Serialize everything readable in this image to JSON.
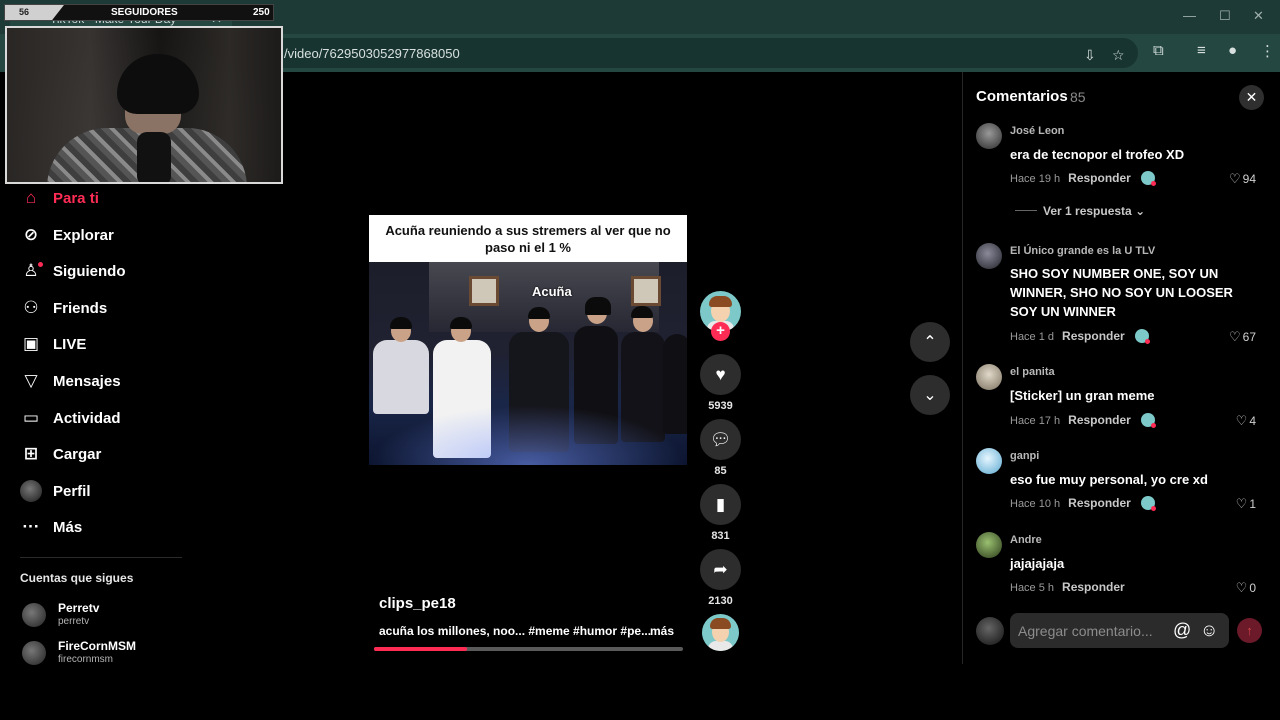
{
  "browser": {
    "tab_title": "TikTok - Make Your Day",
    "url": "/video/7629503052977868050"
  },
  "overlay": {
    "followers_label": "SEGUIDORES",
    "followers_current": "56",
    "followers_goal": "250",
    "followers_progress": 0.22
  },
  "nav": {
    "items": [
      {
        "label": "Para ti",
        "icon": "home-icon",
        "active": true
      },
      {
        "label": "Explorar",
        "icon": "compass-icon"
      },
      {
        "label": "Siguiendo",
        "icon": "following-icon"
      },
      {
        "label": "Friends",
        "icon": "friends-icon"
      },
      {
        "label": "LIVE",
        "icon": "live-icon"
      },
      {
        "label": "Mensajes",
        "icon": "messages-icon"
      },
      {
        "label": "Actividad",
        "icon": "activity-icon"
      },
      {
        "label": "Cargar",
        "icon": "upload-icon"
      },
      {
        "label": "Perfil",
        "icon": "profile-avatar"
      },
      {
        "label": "Más",
        "icon": "more-icon"
      }
    ],
    "following_title": "Cuentas que sigues",
    "accounts": [
      {
        "name": "Perretv",
        "handle": "perretv"
      },
      {
        "name": "FireCornMSM",
        "handle": "firecornmsm"
      }
    ]
  },
  "video": {
    "caption": "Acuña reuniendo a sus stremers al ver que no paso ni el 1 %",
    "overlay_label": "Acuña",
    "username": "clips_pe18",
    "description": "acuña los millones, noo... #meme #humor #pe...",
    "more_label": "más",
    "progress": 0.3
  },
  "actions": {
    "likes": "5939",
    "comments": "85",
    "saves": "831",
    "shares": "2130"
  },
  "comments_panel": {
    "title": "Comentarios",
    "count": "85",
    "reply_label": "Responder",
    "view_replies": "Ver 1 respuesta",
    "input_placeholder": "Agregar comentario...",
    "items": [
      {
        "user": "José Leon",
        "text": "era de tecnopor el trofeo XD",
        "time": "Hace 19 h",
        "likes": "94",
        "avatar": "#4a4a4a"
      },
      {
        "user": "El Único grande es la U TLV",
        "text": "SHO SOY NUMBER ONE, SOY UN WINNER, SHO NO SOY UN LOOSER SOY UN WINNER",
        "time": "Hace 1 d",
        "likes": "67",
        "avatar": "#3a3a44"
      },
      {
        "user": "el panita",
        "text": "[Sticker] un gran meme",
        "time": "Hace 17 h",
        "likes": "4",
        "avatar": "#b8b0a0"
      },
      {
        "user": "ganpi",
        "text": "eso fue muy personal, yo cre xd",
        "time": "Hace 10 h",
        "likes": "1",
        "avatar": "#9fd7f0"
      },
      {
        "user": "Andre",
        "text": "jajajajaja",
        "time": "Hace 5 h",
        "likes": "0",
        "avatar": "#5a7a3a"
      }
    ]
  },
  "colors": {
    "accent": "#fe2c55",
    "browser_frame": "#244741"
  }
}
